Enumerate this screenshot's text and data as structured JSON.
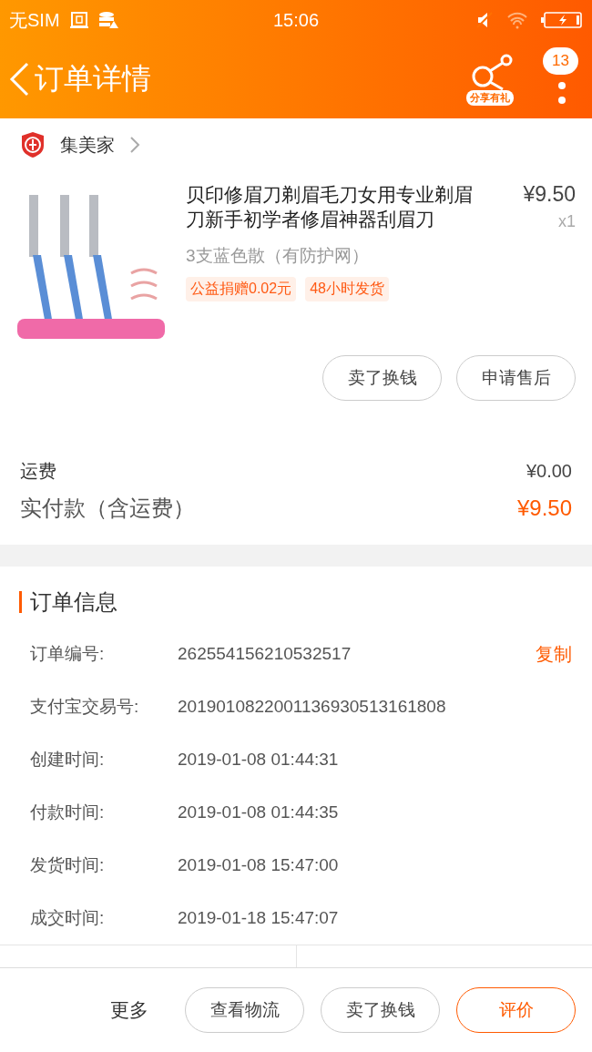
{
  "status_bar": {
    "carrier": "无SIM",
    "time": "15:06"
  },
  "header": {
    "title": "订单详情",
    "share_label": "分享有礼",
    "badge": "13"
  },
  "store": {
    "name": "集美家"
  },
  "product": {
    "image": {
      "kind": "picture"
    },
    "title": "贝印修眉刀剃眉毛刀女用专业剃眉刀新手初学者修眉神器刮眉刀",
    "price": "¥9.50",
    "quantity": "x1",
    "variant": "3支蓝色散（有防护网）",
    "tags": [
      "公益捐赠0.02元",
      "48小时发货"
    ],
    "actions": [
      "卖了换钱",
      "申请售后"
    ]
  },
  "fees": [
    {
      "label": "运费",
      "value": "¥0.00",
      "kind": "plain"
    },
    {
      "label": "实付款（含运费）",
      "value": "¥9.50",
      "kind": "total"
    }
  ],
  "order_info": {
    "title": "订单信息",
    "rows": [
      {
        "label": "订单编号:",
        "value": "262554156210532517",
        "action": "复制"
      },
      {
        "label": "支付宝交易号:",
        "value": "2019010822001136930513161808"
      },
      {
        "label": "创建时间:",
        "value": "2019-01-08 01:44:31"
      },
      {
        "label": "付款时间:",
        "value": "2019-01-08 01:44:35"
      },
      {
        "label": "发货时间:",
        "value": "2019-01-08 15:47:00"
      },
      {
        "label": "成交时间:",
        "value": "2019-01-18 15:47:07"
      }
    ]
  },
  "bottom_bar": {
    "more": "更多",
    "buttons": [
      {
        "label": "查看物流",
        "primary": false
      },
      {
        "label": "卖了换钱",
        "primary": false
      },
      {
        "label": "评价",
        "primary": true
      }
    ]
  }
}
